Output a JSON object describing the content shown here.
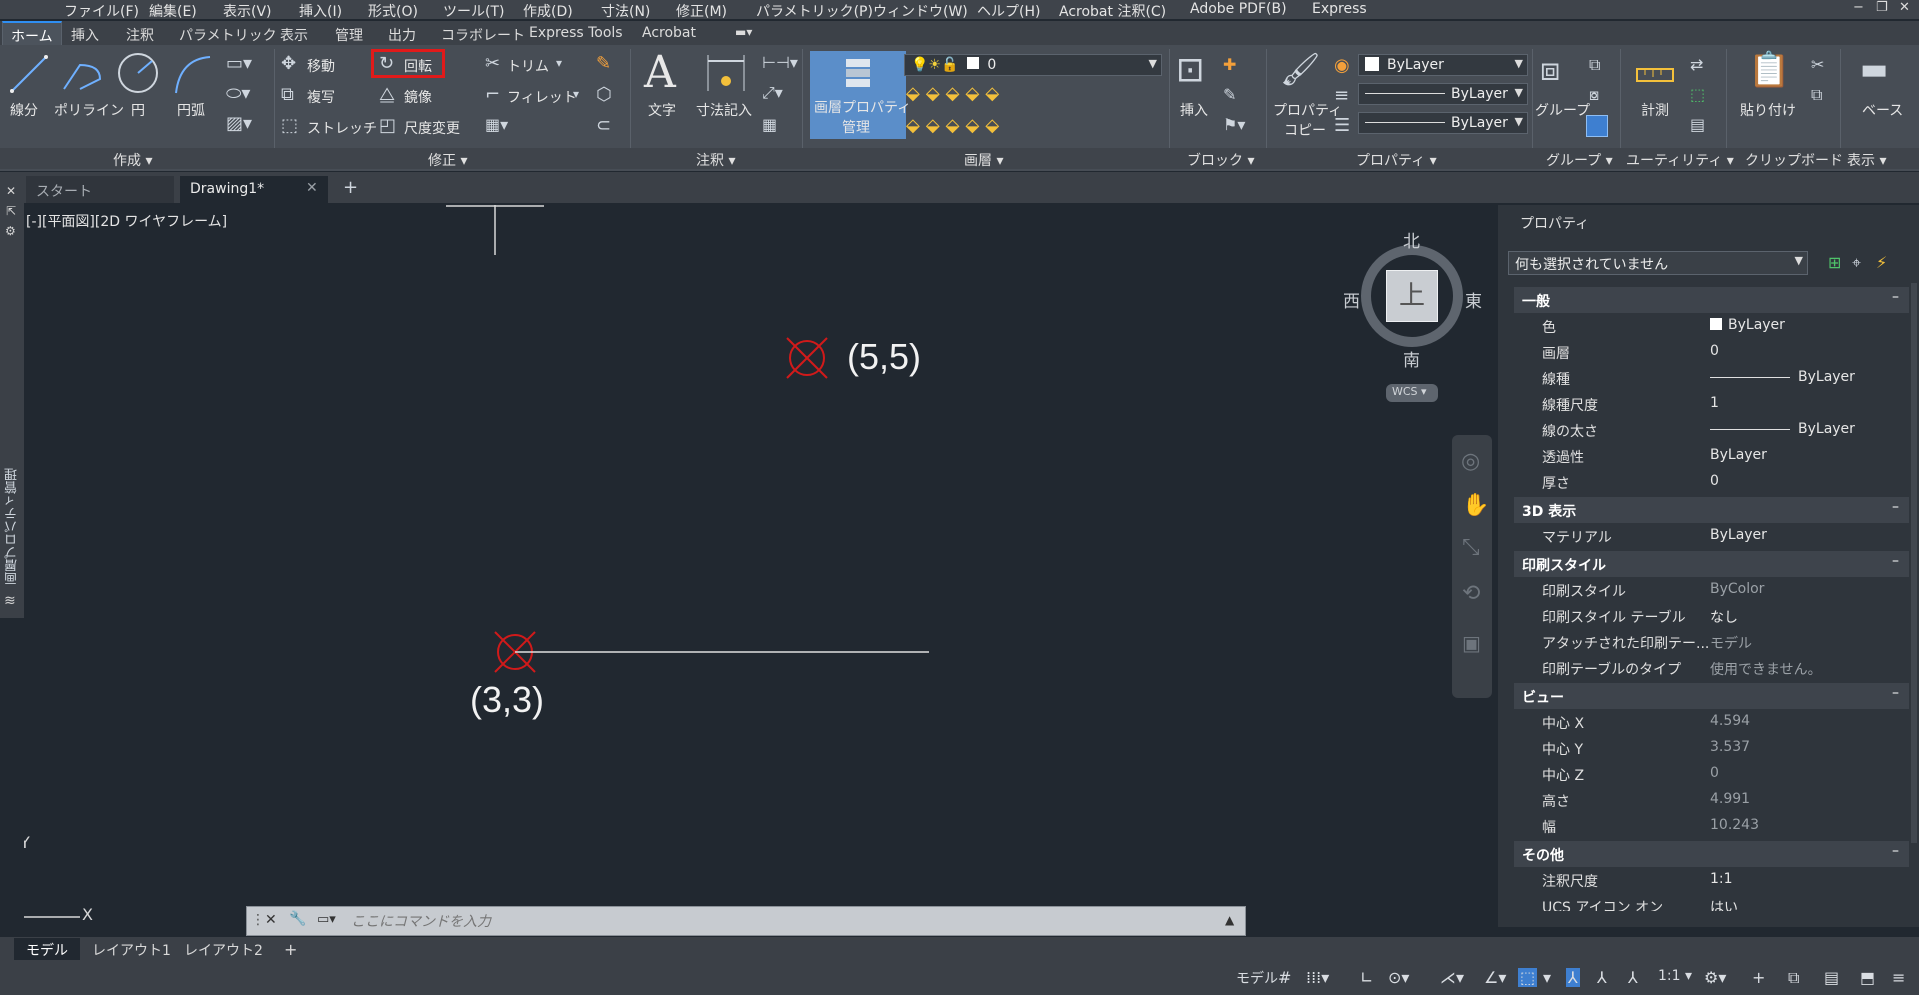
{
  "menubar": {
    "items": [
      "ファイル(F)",
      "編集(E)",
      "表示(V)",
      "挿入(I)",
      "形式(O)",
      "ツール(T)",
      "作成(D)",
      "寸法(N)",
      "修正(M)",
      "パラメトリック(P)",
      "ウィンドウ(W)",
      "ヘルプ(H)",
      "Acrobat 注釈(C)",
      "Adobe PDF(B)",
      "Express"
    ]
  },
  "ribbon_tabs": [
    "ホーム",
    "挿入",
    "注釈",
    "パラメトリック",
    "表示",
    "管理",
    "出力",
    "コラボレート",
    "Express Tools",
    "Acrobat"
  ],
  "ribbon": {
    "draw": {
      "line": "線分",
      "polyline": "ポリライン",
      "circle": "円",
      "arc": "円弧",
      "panel": "作成"
    },
    "modify": {
      "move": "移動",
      "rotate": "回転",
      "trim": "トリム",
      "copy": "複写",
      "mirror": "鏡像",
      "fillet": "フィレット",
      "stretch": "ストレッチ",
      "scale": "尺度変更",
      "panel": "修正"
    },
    "annotation": {
      "text": "文字",
      "dimension": "寸法記入",
      "panel": "注釈"
    },
    "layers": {
      "layer_props_line1": "画層プロパティ",
      "layer_props_line2": "管理",
      "current_layer": "0",
      "panel": "画層"
    },
    "block": {
      "insert": "挿入",
      "panel": "ブロック"
    },
    "properties": {
      "match_line1": "プロパティ",
      "match_line2": "コピー",
      "color": "ByLayer",
      "linetype": "ByLayer",
      "lineweight": "ByLayer",
      "panel": "プロパティ"
    },
    "groups": {
      "group": "グループ",
      "panel": "グループ"
    },
    "utilities": {
      "measure": "計測",
      "panel": "ユーティリティ"
    },
    "clipboard": {
      "paste": "貼り付け",
      "panel": "クリップボード"
    },
    "view": {
      "base": "ベース",
      "panel": "表示"
    }
  },
  "doc_tabs": {
    "start": "スタート",
    "drawing": "Drawing1*"
  },
  "viewport_label": "[-][平面図][2D ワイヤフレーム]",
  "left_palette_label": "画層プロパティ管理",
  "viewcube": {
    "north": "北",
    "south": "南",
    "east": "東",
    "west": "西",
    "face": "上",
    "wcs": "WCS"
  },
  "canvas": {
    "point1_label": "(5,5)",
    "point2_label": "(3,3)",
    "axis_x": "X",
    "axis_y": "Y"
  },
  "command": {
    "placeholder": "ここにコマンドを入力"
  },
  "properties_panel": {
    "title": "プロパティ",
    "selection": "何も選択されていません",
    "sections": [
      {
        "title": "一般",
        "rows": [
          {
            "k": "色",
            "v": "ByLayer"
          },
          {
            "k": "画層",
            "v": "0"
          },
          {
            "k": "線種",
            "v": "ByLayer"
          },
          {
            "k": "線種尺度",
            "v": "1"
          },
          {
            "k": "線の太さ",
            "v": "ByLayer"
          },
          {
            "k": "透過性",
            "v": "ByLayer"
          },
          {
            "k": "厚さ",
            "v": "0"
          }
        ]
      },
      {
        "title": "3D 表示",
        "rows": [
          {
            "k": "マテリアル",
            "v": "ByLayer"
          }
        ]
      },
      {
        "title": "印刷スタイル",
        "rows": [
          {
            "k": "印刷スタイル",
            "v": "ByColor"
          },
          {
            "k": "印刷スタイル テーブル",
            "v": "なし"
          },
          {
            "k": "アタッチされた印刷テー...",
            "v": "モデル"
          },
          {
            "k": "印刷テーブルのタイプ",
            "v": "使用できません。"
          }
        ]
      },
      {
        "title": "ビュー",
        "rows": [
          {
            "k": "中心 X",
            "v": "4.594"
          },
          {
            "k": "中心 Y",
            "v": "3.537"
          },
          {
            "k": "中心 Z",
            "v": "0"
          },
          {
            "k": "高さ",
            "v": "4.991"
          },
          {
            "k": "幅",
            "v": "10.243"
          }
        ]
      },
      {
        "title": "その他",
        "rows": [
          {
            "k": "注釈尺度",
            "v": "1:1"
          },
          {
            "k": "UCS アイコン オン",
            "v": "はい"
          }
        ]
      }
    ]
  },
  "layout_tabs": [
    "モデル",
    "レイアウト1",
    "レイアウト2"
  ],
  "statusbar": {
    "model": "モデル",
    "scale": "1:1"
  },
  "colors": {
    "accent": "#2f8ff3",
    "highlight_box": "#e11a1a",
    "point_marker": "#d11a1a"
  }
}
